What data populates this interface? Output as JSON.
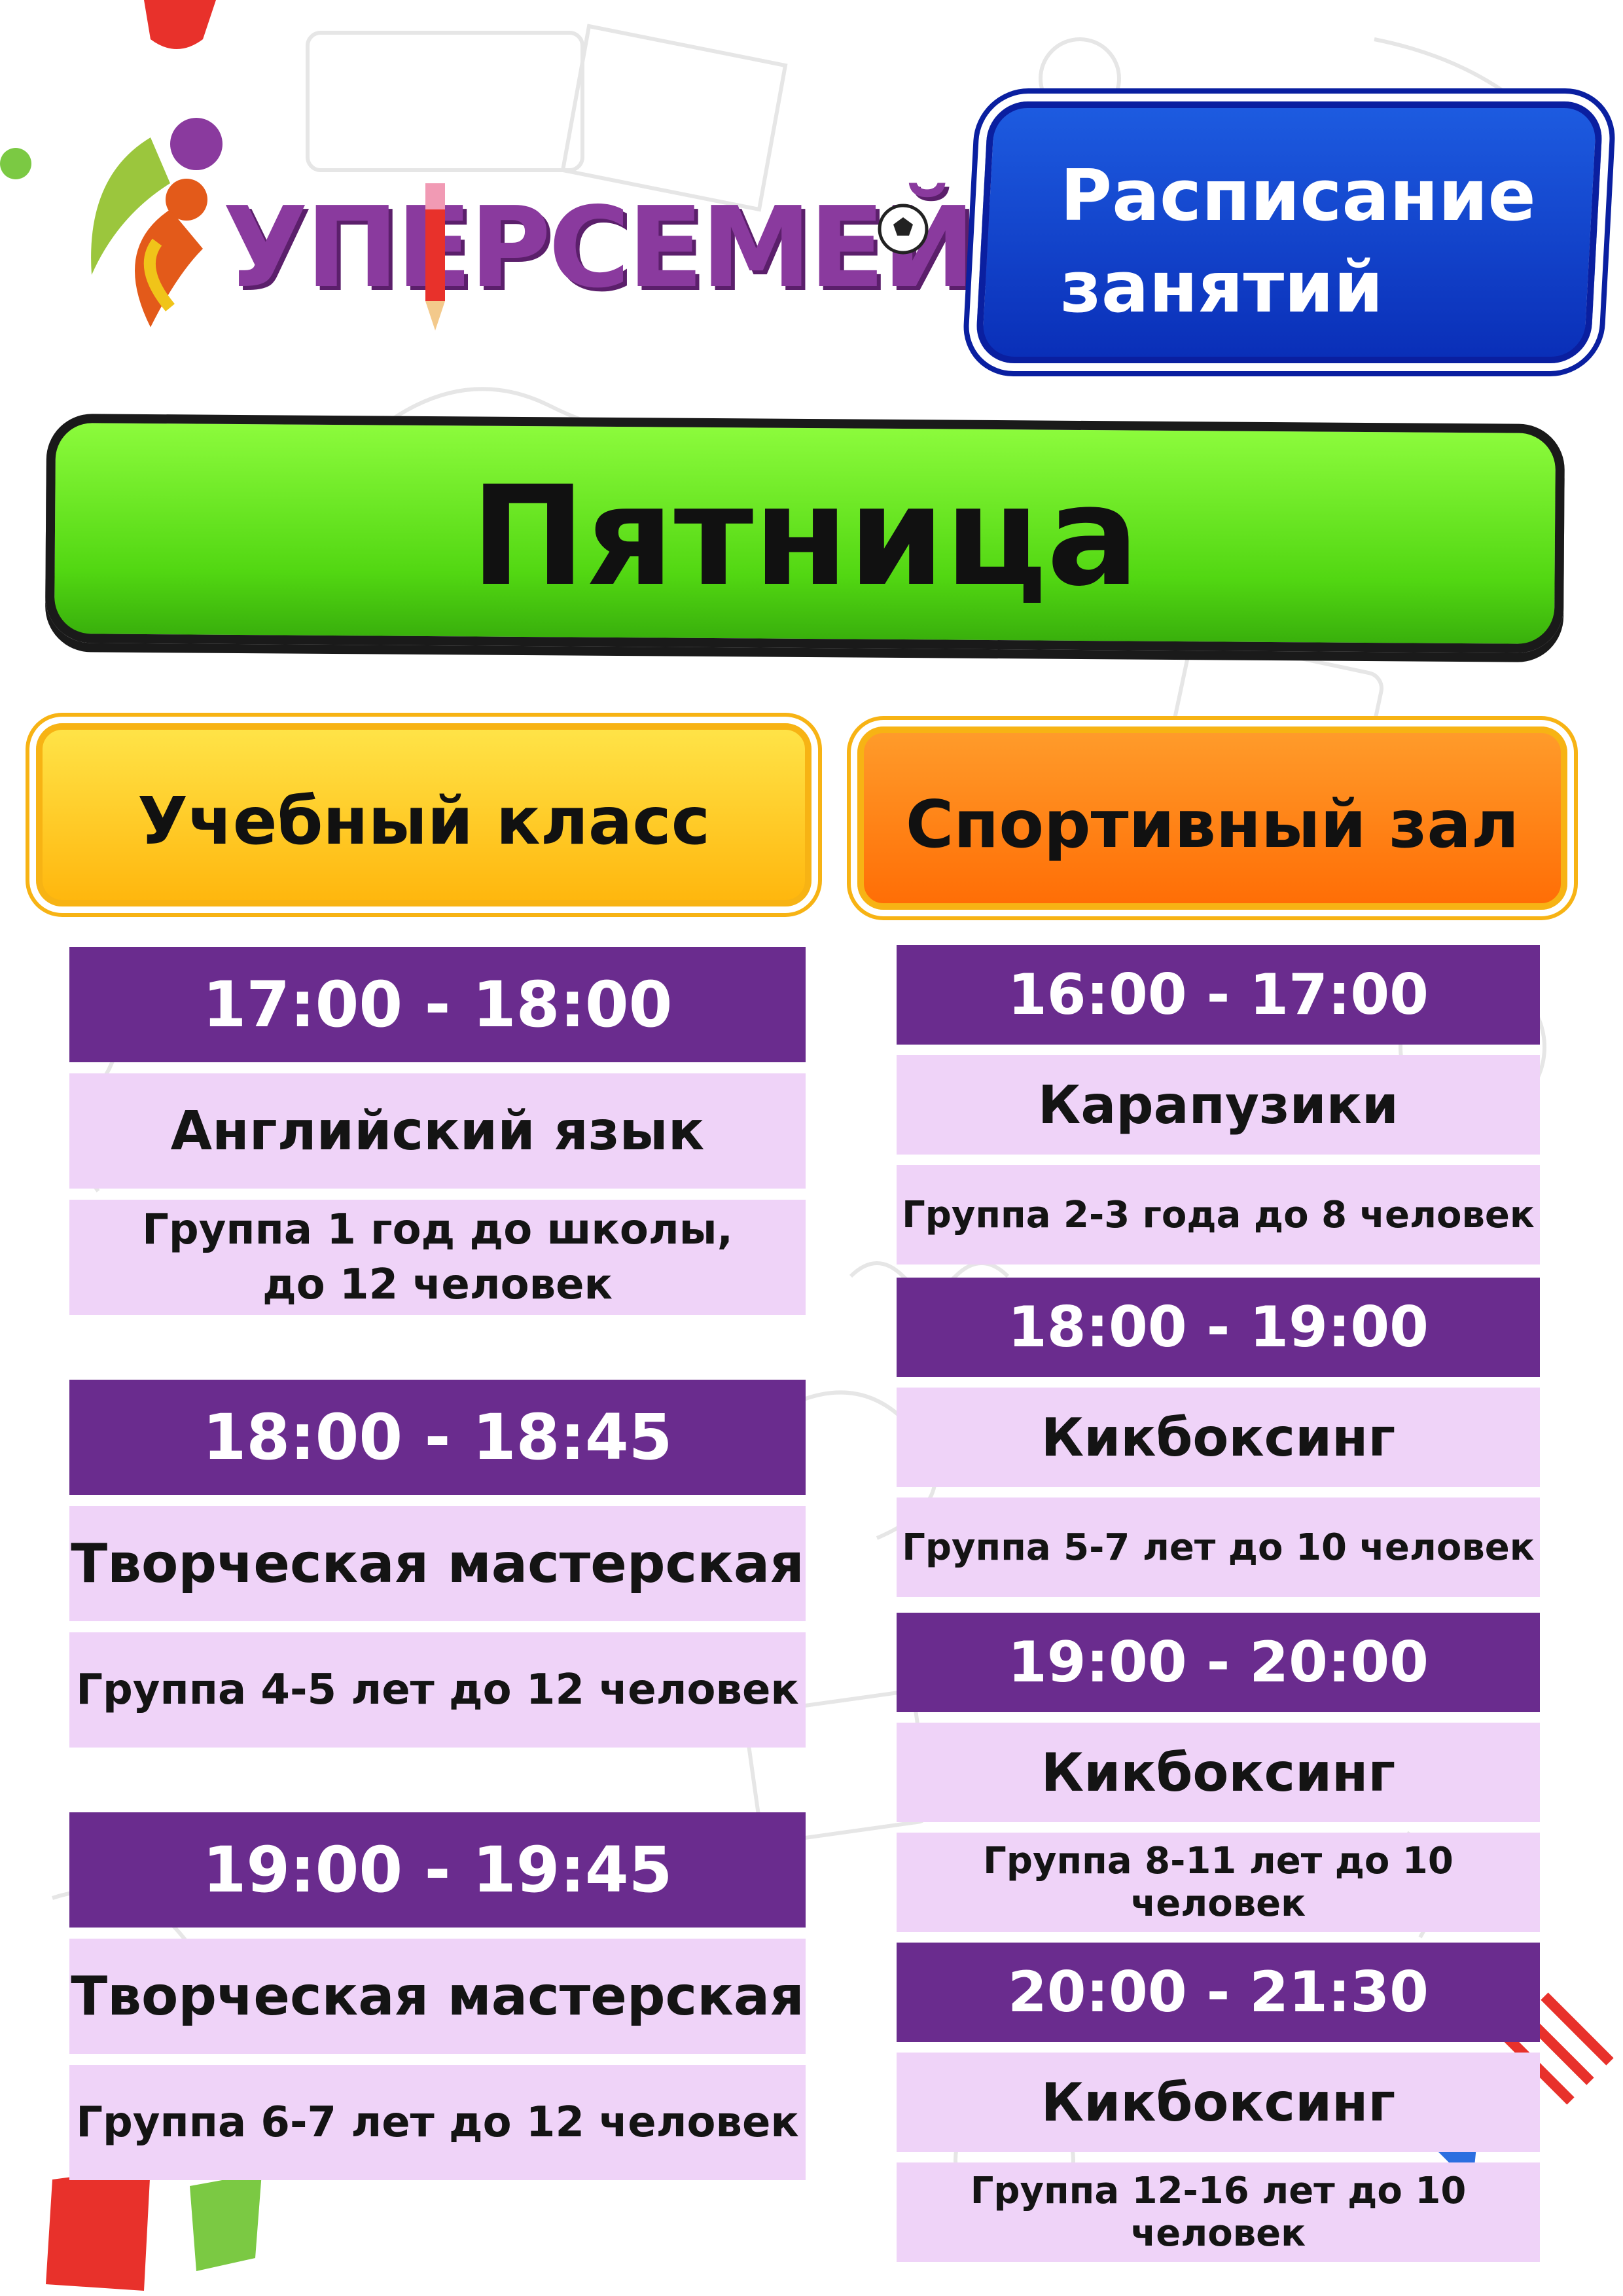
{
  "logo": {
    "text": "УПЕРСЕМЕЙКА"
  },
  "header": {
    "title": "Расписание\nзанятий"
  },
  "day": {
    "label": "Пятница"
  },
  "columns": [
    {
      "title": "Учебный класс",
      "slots": [
        {
          "time": "17:00 - 18:00",
          "activity": "Английский язык",
          "group": "Группа 1 год до школы,\nдо 12 человек"
        },
        {
          "time": "18:00 - 18:45",
          "activity": "Творческая мастерская",
          "group": "Группа 4-5 лет до 12 человек"
        },
        {
          "time": "19:00 - 19:45",
          "activity": "Творческая мастерская",
          "group": "Группа 6-7 лет до 12 человек"
        }
      ]
    },
    {
      "title": "Спортивный зал",
      "slots": [
        {
          "time": "16:00 - 17:00",
          "activity": "Карапузики",
          "group": "Группа 2-3 года до 8 человек"
        },
        {
          "time": "18:00 - 19:00",
          "activity": "Кикбоксинг",
          "group": "Группа 5-7 лет до 10 человек"
        },
        {
          "time": "19:00 - 20:00",
          "activity": "Кикбоксинг",
          "group": "Группа 8-11 лет до 10 человек"
        },
        {
          "time": "20:00 - 21:30",
          "activity": "Кикбоксинг",
          "group": "Группа 12-16 лет до 10 человек"
        }
      ]
    }
  ],
  "colors": {
    "purple": "#6a2c8e",
    "lilac": "#efd3f8",
    "green": "#52d712",
    "blue": "#0a2fb8",
    "yellow": "#ffb70e",
    "orange": "#ff6e06"
  }
}
